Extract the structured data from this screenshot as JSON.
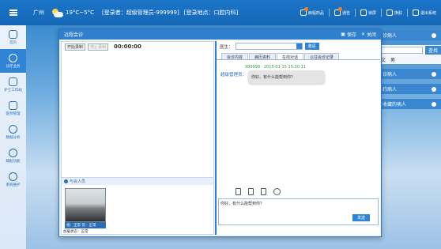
{
  "topbar": {
    "city": "广州",
    "temperature": "19°C~5°C",
    "login_user": "[登录者：超级管理员-999999]",
    "login_place": "[登录地点：口腔内科]",
    "right_items": [
      "病程药品",
      "通告",
      "锁屏",
      "换肤",
      "退出系统"
    ]
  },
  "sidebar": {
    "items": [
      {
        "label": "首页"
      },
      {
        "label": "诊疗业务"
      },
      {
        "label": "护士工作站"
      },
      {
        "label": "医师管理"
      },
      {
        "label": "数据分析"
      },
      {
        "label": "辅助功能"
      },
      {
        "label": "系统维护"
      }
    ]
  },
  "background_panel": {
    "rows": [
      "诊病人",
      "约病人",
      "收藏的病人"
    ],
    "search_button": "查找",
    "sub_items": [
      "文",
      "男"
    ]
  },
  "modal": {
    "title": "远程会诊",
    "save_label": "保存",
    "close_label": "关闭",
    "recording": {
      "start_label": "开始录制",
      "stop_label": "停止录制",
      "timer": "00:00:00"
    },
    "participants_label": "与会人员",
    "video_status": "视：正常 音：正常",
    "network_status": "加载状态：正常",
    "doctor_label": "医生：",
    "invite_label": "邀请",
    "tabs": [
      "会诊内容",
      "病历资料",
      "在线对话",
      "以往会诊记录"
    ],
    "chat": {
      "meta": "999999 · 2015-01-15 15:30:11",
      "sender": "超级管理员：",
      "message": "你好，有什么能帮到你？"
    },
    "input_value": "你好，有什么能帮到你？",
    "send_label": "发送"
  }
}
